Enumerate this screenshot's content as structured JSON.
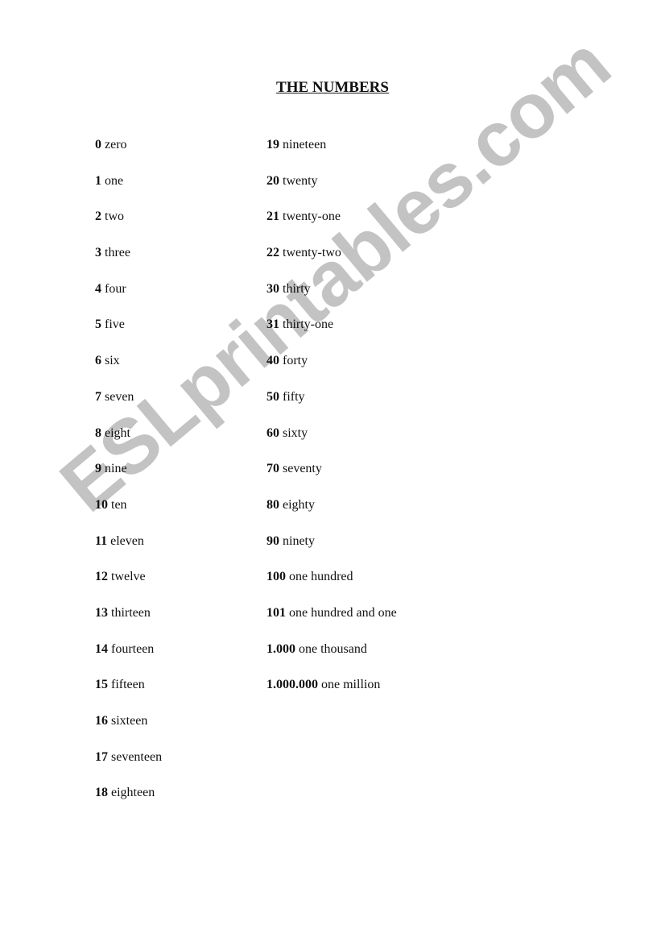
{
  "title": "THE NUMBERS",
  "watermark": "ESLprintables.com",
  "left_column": [
    {
      "num": "0",
      "word": "zero"
    },
    {
      "num": "1",
      "word": "one"
    },
    {
      "num": "2",
      "word": "two"
    },
    {
      "num": "3",
      "word": "three"
    },
    {
      "num": "4",
      "word": "four"
    },
    {
      "num": "5",
      "word": "five"
    },
    {
      "num": "6",
      "word": "six"
    },
    {
      "num": "7",
      "word": "seven"
    },
    {
      "num": "8",
      "word": "eight"
    },
    {
      "num": "9",
      "word": "nine"
    },
    {
      "num": "10",
      "word": "ten"
    },
    {
      "num": "11",
      "word": "eleven"
    },
    {
      "num": "12",
      "word": "twelve"
    },
    {
      "num": "13",
      "word": "thirteen"
    },
    {
      "num": "14",
      "word": "fourteen"
    },
    {
      "num": "15",
      "word": "fifteen"
    },
    {
      "num": "16",
      "word": "sixteen"
    },
    {
      "num": "17",
      "word": "seventeen"
    },
    {
      "num": "18",
      "word": "eighteen"
    }
  ],
  "right_column": [
    {
      "num": "19",
      "word": "nineteen"
    },
    {
      "num": "20",
      "word": "twenty"
    },
    {
      "num": "21",
      "word": "twenty-one"
    },
    {
      "num": "22",
      "word": "twenty-two"
    },
    {
      "num": "30",
      "word": "thirty"
    },
    {
      "num": "31",
      "word": "thirty-one"
    },
    {
      "num": "40",
      "word": "forty"
    },
    {
      "num": "50",
      "word": "fifty"
    },
    {
      "num": "60",
      "word": "sixty"
    },
    {
      "num": "70",
      "word": "seventy"
    },
    {
      "num": "80",
      "word": "eighty"
    },
    {
      "num": "90",
      "word": "ninety"
    },
    {
      "num": "100",
      "word": "one hundred"
    },
    {
      "num": "101",
      "word": "one hundred and one"
    },
    {
      "num": "1.000",
      "word": "one thousand"
    },
    {
      "num": "1.000.000",
      "word": "one million"
    }
  ]
}
